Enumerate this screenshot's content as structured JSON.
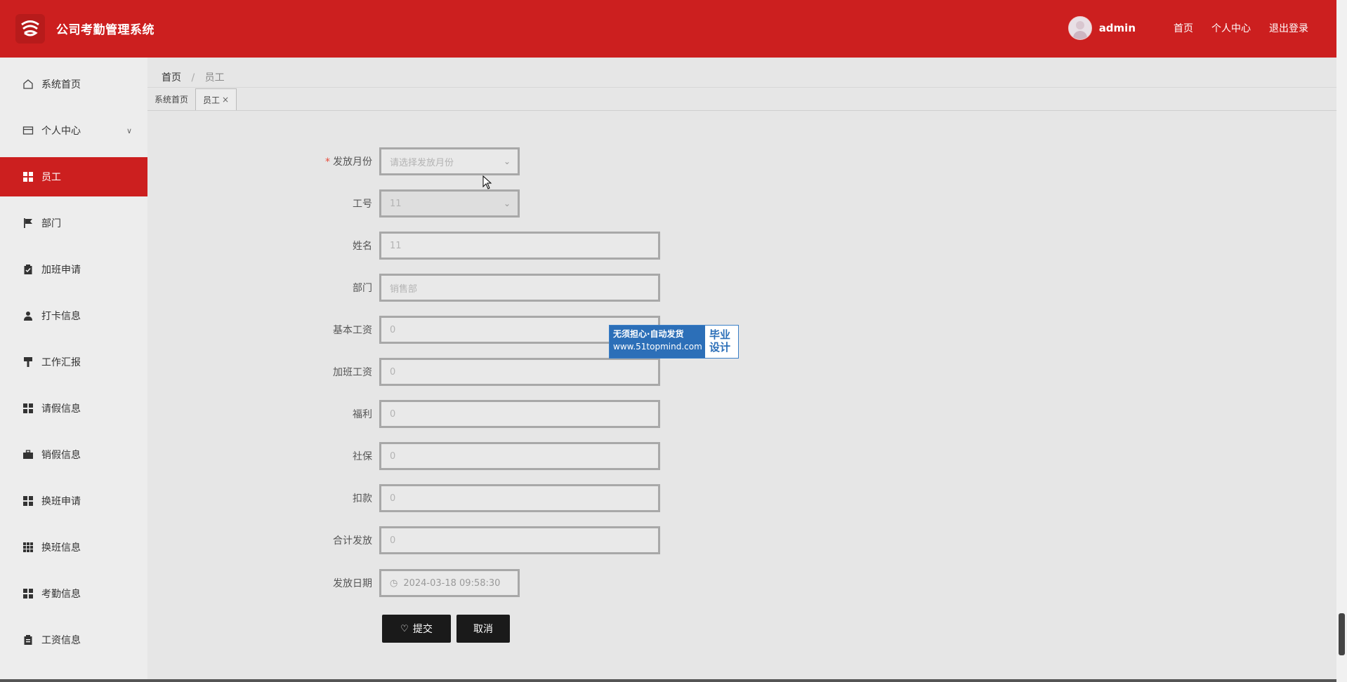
{
  "header": {
    "app_title": "公司考勤管理系统",
    "username": "admin",
    "links": [
      "首页",
      "个人中心",
      "退出登录"
    ]
  },
  "sidebar": {
    "items": [
      {
        "label": "系统首页",
        "icon": "home-icon"
      },
      {
        "label": "个人中心",
        "icon": "card-icon",
        "expandable": true
      },
      {
        "label": "员工",
        "icon": "grid-icon",
        "active": true
      },
      {
        "label": "部门",
        "icon": "flag-icon"
      },
      {
        "label": "加班申请",
        "icon": "clipboard-check-icon"
      },
      {
        "label": "打卡信息",
        "icon": "user-icon"
      },
      {
        "label": "工作汇报",
        "icon": "brush-icon"
      },
      {
        "label": "请假信息",
        "icon": "grid-icon"
      },
      {
        "label": "销假信息",
        "icon": "briefcase-icon"
      },
      {
        "label": "换班申请",
        "icon": "grid-icon"
      },
      {
        "label": "换班信息",
        "icon": "grid9-icon"
      },
      {
        "label": "考勤信息",
        "icon": "grid-icon"
      },
      {
        "label": "工资信息",
        "icon": "clipboard-icon"
      }
    ]
  },
  "breadcrumb": {
    "home": "首页",
    "separator": "/",
    "current": "员工"
  },
  "tabs": [
    {
      "label": "系统首页"
    },
    {
      "label": "员工",
      "close": "×",
      "active": true
    }
  ],
  "form": {
    "month": {
      "label": "发放月份",
      "required_mark": "*",
      "placeholder": "请选择发放月份"
    },
    "employee_no": {
      "label": "工号",
      "value": "11"
    },
    "name": {
      "label": "姓名",
      "value": "11"
    },
    "department": {
      "label": "部门",
      "value": "销售部"
    },
    "base_salary": {
      "label": "基本工资",
      "value": "0"
    },
    "overtime_pay": {
      "label": "加班工资",
      "value": "0"
    },
    "welfare": {
      "label": "福利",
      "value": "0"
    },
    "social_security": {
      "label": "社保",
      "value": "0"
    },
    "deduction": {
      "label": "扣款",
      "value": "0"
    },
    "total": {
      "label": "合计发放",
      "value": "0"
    },
    "pay_date": {
      "label": "发放日期",
      "value": "2024-03-18 09:58:30"
    },
    "submit_label": "提交",
    "cancel_label": "取消"
  },
  "watermark": {
    "line1": "无须担心·自动发货",
    "line2": "www.51topmind.com",
    "right1": "毕业",
    "right2": "设计"
  },
  "colors": {
    "primary": "#cc1f1f",
    "button": "#1a1a1a",
    "watermark_blue": "#2c6fb8"
  }
}
